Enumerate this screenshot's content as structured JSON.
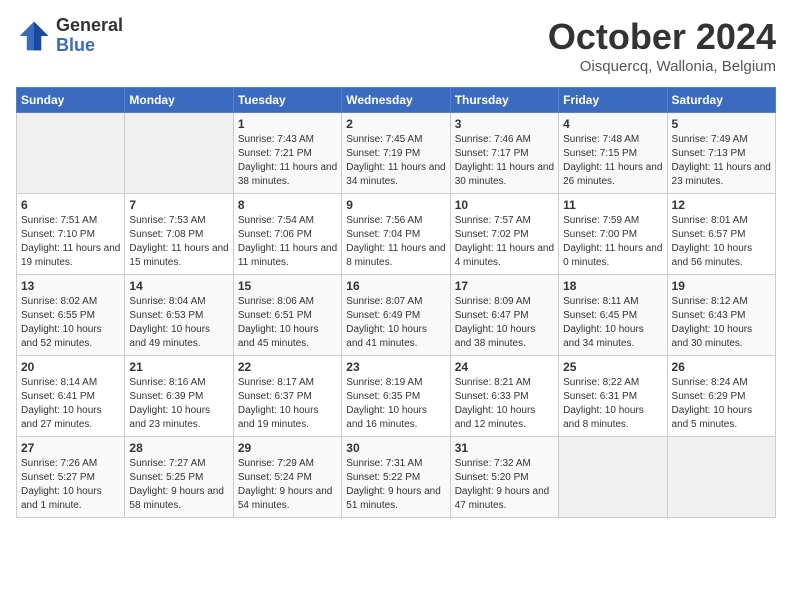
{
  "header": {
    "logo_line1": "General",
    "logo_line2": "Blue",
    "month": "October 2024",
    "location": "Oisquercq, Wallonia, Belgium"
  },
  "weekdays": [
    "Sunday",
    "Monday",
    "Tuesday",
    "Wednesday",
    "Thursday",
    "Friday",
    "Saturday"
  ],
  "weeks": [
    [
      {
        "day": "",
        "sunrise": "",
        "sunset": "",
        "daylight": ""
      },
      {
        "day": "",
        "sunrise": "",
        "sunset": "",
        "daylight": ""
      },
      {
        "day": "1",
        "sunrise": "Sunrise: 7:43 AM",
        "sunset": "Sunset: 7:21 PM",
        "daylight": "Daylight: 11 hours and 38 minutes."
      },
      {
        "day": "2",
        "sunrise": "Sunrise: 7:45 AM",
        "sunset": "Sunset: 7:19 PM",
        "daylight": "Daylight: 11 hours and 34 minutes."
      },
      {
        "day": "3",
        "sunrise": "Sunrise: 7:46 AM",
        "sunset": "Sunset: 7:17 PM",
        "daylight": "Daylight: 11 hours and 30 minutes."
      },
      {
        "day": "4",
        "sunrise": "Sunrise: 7:48 AM",
        "sunset": "Sunset: 7:15 PM",
        "daylight": "Daylight: 11 hours and 26 minutes."
      },
      {
        "day": "5",
        "sunrise": "Sunrise: 7:49 AM",
        "sunset": "Sunset: 7:13 PM",
        "daylight": "Daylight: 11 hours and 23 minutes."
      }
    ],
    [
      {
        "day": "6",
        "sunrise": "Sunrise: 7:51 AM",
        "sunset": "Sunset: 7:10 PM",
        "daylight": "Daylight: 11 hours and 19 minutes."
      },
      {
        "day": "7",
        "sunrise": "Sunrise: 7:53 AM",
        "sunset": "Sunset: 7:08 PM",
        "daylight": "Daylight: 11 hours and 15 minutes."
      },
      {
        "day": "8",
        "sunrise": "Sunrise: 7:54 AM",
        "sunset": "Sunset: 7:06 PM",
        "daylight": "Daylight: 11 hours and 11 minutes."
      },
      {
        "day": "9",
        "sunrise": "Sunrise: 7:56 AM",
        "sunset": "Sunset: 7:04 PM",
        "daylight": "Daylight: 11 hours and 8 minutes."
      },
      {
        "day": "10",
        "sunrise": "Sunrise: 7:57 AM",
        "sunset": "Sunset: 7:02 PM",
        "daylight": "Daylight: 11 hours and 4 minutes."
      },
      {
        "day": "11",
        "sunrise": "Sunrise: 7:59 AM",
        "sunset": "Sunset: 7:00 PM",
        "daylight": "Daylight: 11 hours and 0 minutes."
      },
      {
        "day": "12",
        "sunrise": "Sunrise: 8:01 AM",
        "sunset": "Sunset: 6:57 PM",
        "daylight": "Daylight: 10 hours and 56 minutes."
      }
    ],
    [
      {
        "day": "13",
        "sunrise": "Sunrise: 8:02 AM",
        "sunset": "Sunset: 6:55 PM",
        "daylight": "Daylight: 10 hours and 52 minutes."
      },
      {
        "day": "14",
        "sunrise": "Sunrise: 8:04 AM",
        "sunset": "Sunset: 6:53 PM",
        "daylight": "Daylight: 10 hours and 49 minutes."
      },
      {
        "day": "15",
        "sunrise": "Sunrise: 8:06 AM",
        "sunset": "Sunset: 6:51 PM",
        "daylight": "Daylight: 10 hours and 45 minutes."
      },
      {
        "day": "16",
        "sunrise": "Sunrise: 8:07 AM",
        "sunset": "Sunset: 6:49 PM",
        "daylight": "Daylight: 10 hours and 41 minutes."
      },
      {
        "day": "17",
        "sunrise": "Sunrise: 8:09 AM",
        "sunset": "Sunset: 6:47 PM",
        "daylight": "Daylight: 10 hours and 38 minutes."
      },
      {
        "day": "18",
        "sunrise": "Sunrise: 8:11 AM",
        "sunset": "Sunset: 6:45 PM",
        "daylight": "Daylight: 10 hours and 34 minutes."
      },
      {
        "day": "19",
        "sunrise": "Sunrise: 8:12 AM",
        "sunset": "Sunset: 6:43 PM",
        "daylight": "Daylight: 10 hours and 30 minutes."
      }
    ],
    [
      {
        "day": "20",
        "sunrise": "Sunrise: 8:14 AM",
        "sunset": "Sunset: 6:41 PM",
        "daylight": "Daylight: 10 hours and 27 minutes."
      },
      {
        "day": "21",
        "sunrise": "Sunrise: 8:16 AM",
        "sunset": "Sunset: 6:39 PM",
        "daylight": "Daylight: 10 hours and 23 minutes."
      },
      {
        "day": "22",
        "sunrise": "Sunrise: 8:17 AM",
        "sunset": "Sunset: 6:37 PM",
        "daylight": "Daylight: 10 hours and 19 minutes."
      },
      {
        "day": "23",
        "sunrise": "Sunrise: 8:19 AM",
        "sunset": "Sunset: 6:35 PM",
        "daylight": "Daylight: 10 hours and 16 minutes."
      },
      {
        "day": "24",
        "sunrise": "Sunrise: 8:21 AM",
        "sunset": "Sunset: 6:33 PM",
        "daylight": "Daylight: 10 hours and 12 minutes."
      },
      {
        "day": "25",
        "sunrise": "Sunrise: 8:22 AM",
        "sunset": "Sunset: 6:31 PM",
        "daylight": "Daylight: 10 hours and 8 minutes."
      },
      {
        "day": "26",
        "sunrise": "Sunrise: 8:24 AM",
        "sunset": "Sunset: 6:29 PM",
        "daylight": "Daylight: 10 hours and 5 minutes."
      }
    ],
    [
      {
        "day": "27",
        "sunrise": "Sunrise: 7:26 AM",
        "sunset": "Sunset: 5:27 PM",
        "daylight": "Daylight: 10 hours and 1 minute."
      },
      {
        "day": "28",
        "sunrise": "Sunrise: 7:27 AM",
        "sunset": "Sunset: 5:25 PM",
        "daylight": "Daylight: 9 hours and 58 minutes."
      },
      {
        "day": "29",
        "sunrise": "Sunrise: 7:29 AM",
        "sunset": "Sunset: 5:24 PM",
        "daylight": "Daylight: 9 hours and 54 minutes."
      },
      {
        "day": "30",
        "sunrise": "Sunrise: 7:31 AM",
        "sunset": "Sunset: 5:22 PM",
        "daylight": "Daylight: 9 hours and 51 minutes."
      },
      {
        "day": "31",
        "sunrise": "Sunrise: 7:32 AM",
        "sunset": "Sunset: 5:20 PM",
        "daylight": "Daylight: 9 hours and 47 minutes."
      },
      {
        "day": "",
        "sunrise": "",
        "sunset": "",
        "daylight": ""
      },
      {
        "day": "",
        "sunrise": "",
        "sunset": "",
        "daylight": ""
      }
    ]
  ]
}
